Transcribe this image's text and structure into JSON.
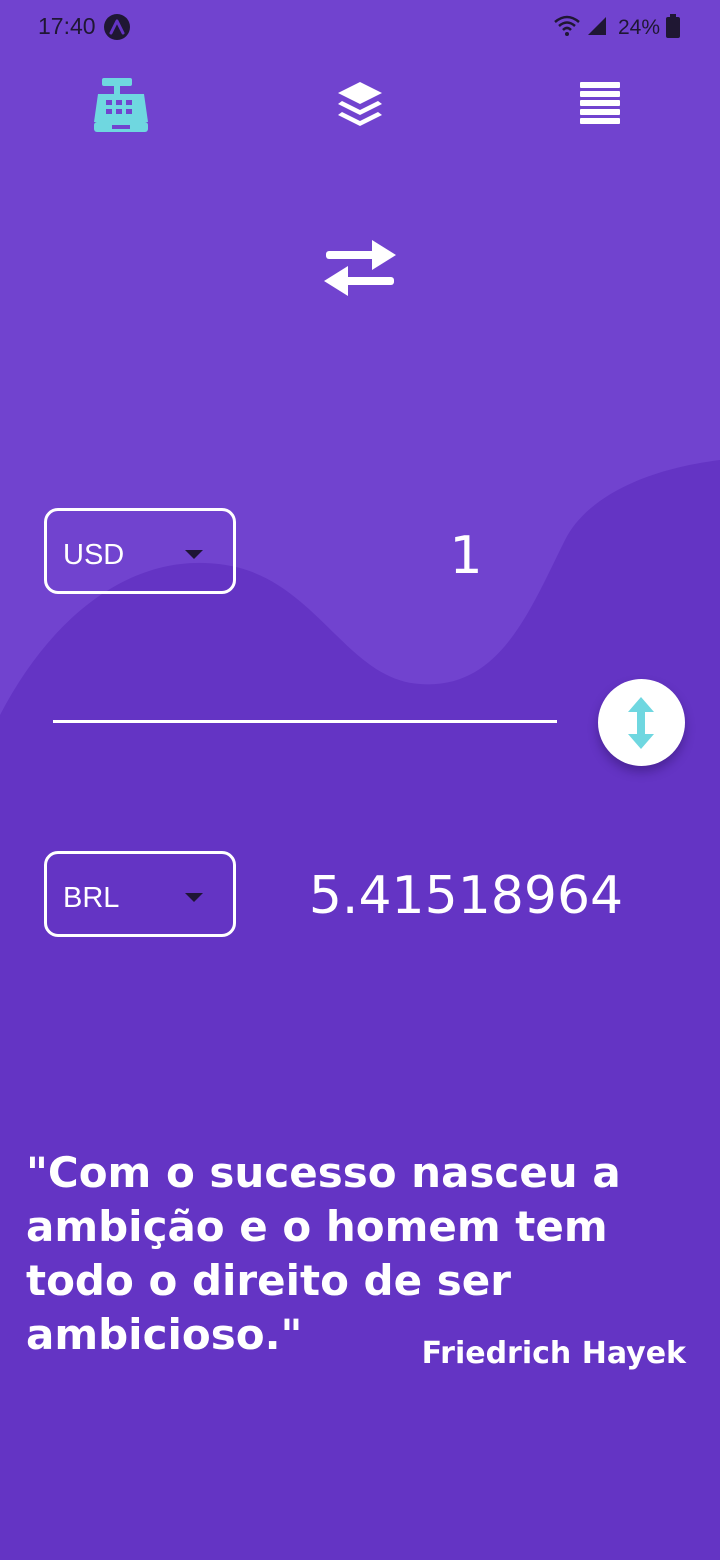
{
  "status_bar": {
    "time": "17:40",
    "battery": "24%"
  },
  "nav": {
    "items": [
      {
        "icon": "cash-register-icon",
        "active": true
      },
      {
        "icon": "layers-icon",
        "active": false
      },
      {
        "icon": "list-icon",
        "active": false
      }
    ]
  },
  "converter": {
    "from_currency": "USD",
    "from_amount": "1",
    "to_currency": "BRL",
    "to_amount": "5.41518964"
  },
  "quote": {
    "text": "\"Com o sucesso nasceu a ambição e o homem tem todo o direito de ser ambicioso.\"",
    "author": "Friedrich Hayek"
  },
  "colors": {
    "background": "#6434c4",
    "wave": "#7143cf",
    "accent": "#6fd7e0",
    "text": "#ffffff"
  }
}
